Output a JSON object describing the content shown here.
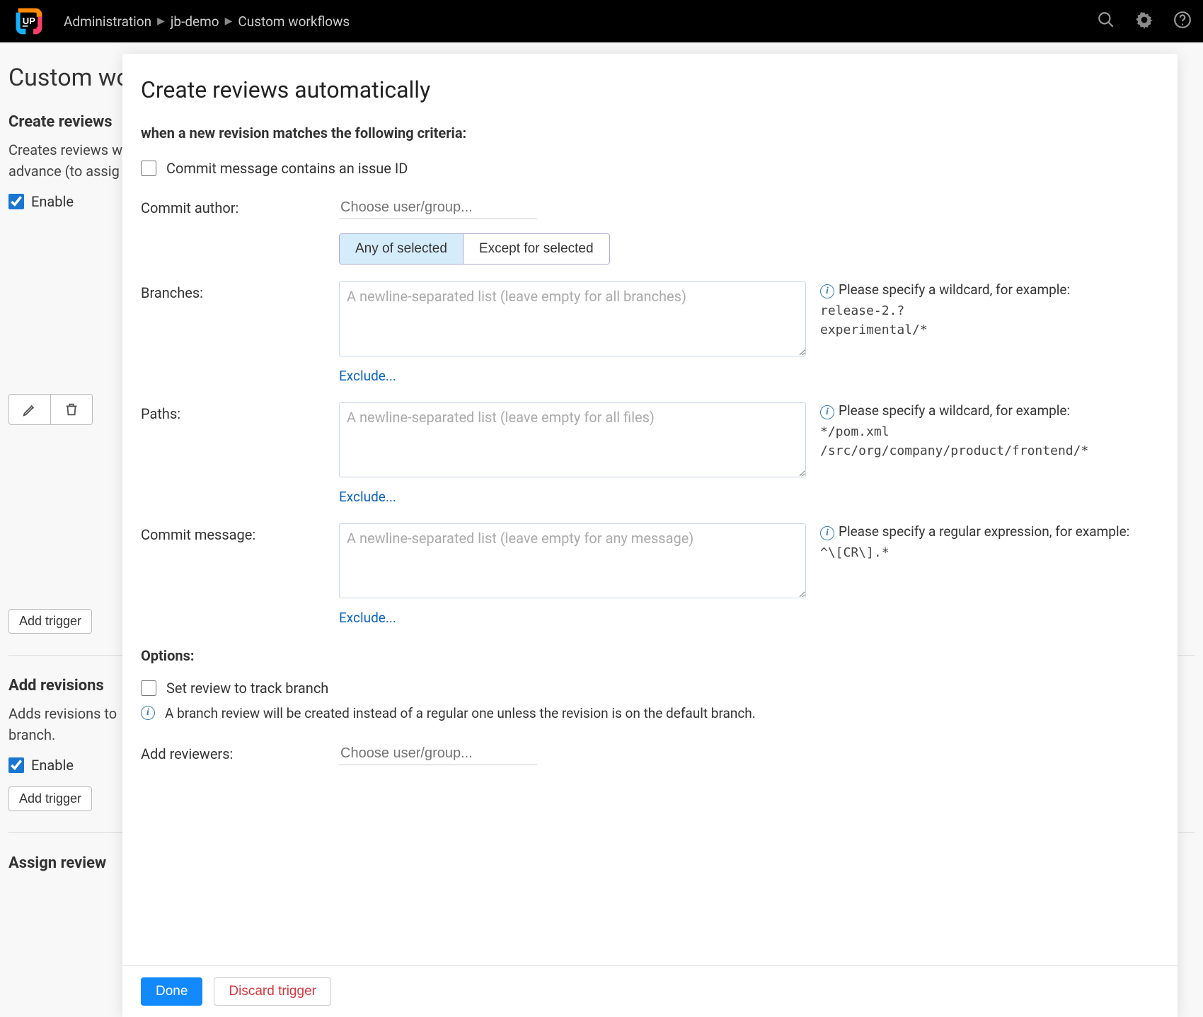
{
  "header": {
    "breadcrumbs": [
      "Administration",
      "jb-demo",
      "Custom workflows"
    ]
  },
  "bg": {
    "pageTitle": "Custom wor",
    "section1Title": "Create reviews",
    "section1Desc1": "Creates reviews w",
    "section1Desc2": "advance (to assig",
    "enableLabel": "Enable",
    "addTriggerLabel": "Add trigger",
    "section2Title": "Add revisions",
    "section2Desc1": "Adds revisions to",
    "section2Desc2": "branch.",
    "section3Title": "Assign review"
  },
  "modal": {
    "title": "Create reviews automatically",
    "subtitle": "when a new revision matches the following criteria:",
    "commitIssueCheckbox": "Commit message contains an issue ID",
    "labels": {
      "commitAuthor": "Commit author:",
      "branches": "Branches:",
      "paths": "Paths:",
      "commitMessage": "Commit message:",
      "addReviewers": "Add reviewers:"
    },
    "chooserPlaceholder": "Choose user/group...",
    "segments": {
      "any": "Any of selected",
      "except": "Except for selected"
    },
    "placeholders": {
      "branches": "A newline-separated list (leave empty for all branches)",
      "paths": "A newline-separated list (leave empty for all files)",
      "commitMessage": "A newline-separated list (leave empty for any message)"
    },
    "excludeLabel": "Exclude...",
    "hints": {
      "wildcard": "Please specify a wildcard, for example:",
      "branchesEx1": "release-2.?",
      "branchesEx2": "experimental/*",
      "pathsEx1": "*/pom.xml",
      "pathsEx2": "/src/org/company/product/frontend/*",
      "regex": "Please specify a regular expression, for example:",
      "regexEx1": "^\\[CR\\].*"
    },
    "optionsTitle": "Options:",
    "trackBranchCheckbox": "Set review to track branch",
    "trackBranchInfo": "A branch review will be created instead of a regular one unless the revision is on the default branch.",
    "buttons": {
      "done": "Done",
      "discard": "Discard trigger"
    }
  }
}
